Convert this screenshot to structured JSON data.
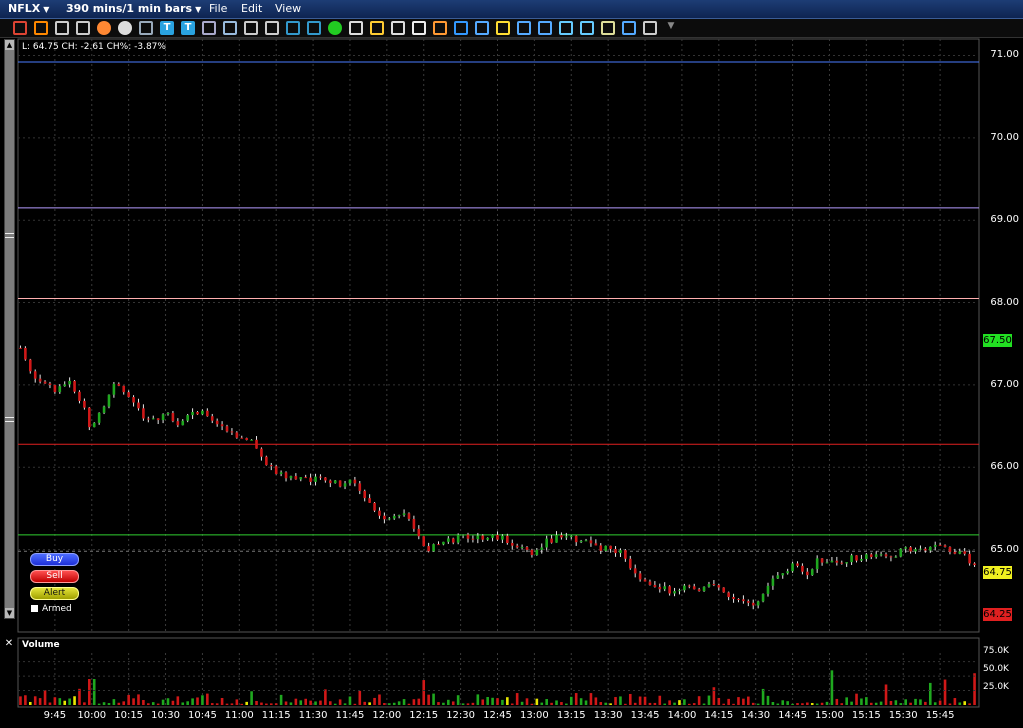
{
  "window": {
    "symbol": "NFLX",
    "timeframe": "390 mins/1 min bars",
    "menu": [
      "File",
      "Edit",
      "View"
    ]
  },
  "toolbar": {
    "icons": [
      "crosshair-icon",
      "arrow-tool-icon",
      "grid-icon",
      "print-icon",
      "snapshot-icon",
      "circle-icon",
      "zoom-window-icon",
      "text-t-icon",
      "text-t2-icon",
      "chart-image-icon",
      "chart-line-icon",
      "layout-icon",
      "layout2-icon",
      "bar-chart-icon",
      "bars-icon",
      "dollar-icon",
      "pointer-icon",
      "zoom-in-icon",
      "zoom-out-icon",
      "hand-icon",
      "crosshair2-icon",
      "undo-icon",
      "settings-icon",
      "paint-icon",
      "ruler-icon",
      "line-tool-icon",
      "line-tool2-icon",
      "line-tool3-icon",
      "resize-icon",
      "pan-icon",
      "wrench-icon",
      "dropdown-icon"
    ]
  },
  "chart": {
    "info": "L: 64.75 CH: -2.61 CH%: -3.87%",
    "y_labels": [
      "71.00",
      "70.00",
      "69.00",
      "68.00",
      "67.00",
      "66.00",
      "65.00"
    ],
    "price_tags": {
      "high": "67.50",
      "last": "64.75",
      "low": "64.25"
    },
    "colors": {
      "up": "#1fa81f",
      "down": "#d01818",
      "background": "#000000"
    },
    "order_buttons": {
      "buy": "Buy",
      "sell": "Sell",
      "alert": "Alert"
    },
    "armed_label": "Armed"
  },
  "volume": {
    "title": "Volume",
    "y_labels": [
      "75.0K",
      "50.0K",
      "25.0K"
    ]
  },
  "x_axis": [
    "9:45",
    "10:00",
    "10:15",
    "10:30",
    "10:45",
    "11:00",
    "11:15",
    "11:30",
    "11:45",
    "12:00",
    "12:15",
    "12:30",
    "12:45",
    "13:00",
    "13:15",
    "13:30",
    "13:45",
    "14:00",
    "14:15",
    "14:30",
    "14:45",
    "15:00",
    "15:15",
    "15:30",
    "15:45"
  ],
  "chart_data": {
    "type": "candlestick",
    "symbol": "NFLX",
    "interval": "1 min",
    "x_range": [
      "9:30",
      "16:00"
    ],
    "ylim": [
      64.0,
      71.2
    ],
    "horizontal_lines": [
      {
        "price": 70.92,
        "color": "#4a7cff"
      },
      {
        "price": 69.15,
        "color": "#b59cff"
      },
      {
        "price": 68.05,
        "color": "#ffb0b0"
      },
      {
        "price": 66.28,
        "color": "#e02020"
      },
      {
        "price": 65.18,
        "color": "#30d030"
      }
    ],
    "price_keypoints": [
      [
        "9:31",
        67.45
      ],
      [
        "9:35",
        67.15
      ],
      [
        "9:40",
        67.05
      ],
      [
        "9:45",
        66.95
      ],
      [
        "9:50",
        67.05
      ],
      [
        "9:55",
        66.85
      ],
      [
        "10:00",
        66.45
      ],
      [
        "10:05",
        66.75
      ],
      [
        "10:10",
        67.05
      ],
      [
        "10:15",
        66.85
      ],
      [
        "10:20",
        66.65
      ],
      [
        "10:25",
        66.55
      ],
      [
        "10:30",
        66.65
      ],
      [
        "10:35",
        66.55
      ],
      [
        "10:40",
        66.65
      ],
      [
        "10:45",
        66.7
      ],
      [
        "10:50",
        66.55
      ],
      [
        "10:55",
        66.4
      ],
      [
        "11:00",
        66.35
      ],
      [
        "11:05",
        66.3
      ],
      [
        "11:10",
        66.1
      ],
      [
        "11:15",
        65.95
      ],
      [
        "11:20",
        65.85
      ],
      [
        "11:25",
        65.9
      ],
      [
        "11:30",
        65.85
      ],
      [
        "11:35",
        65.85
      ],
      [
        "11:40",
        65.8
      ],
      [
        "11:45",
        65.85
      ],
      [
        "11:50",
        65.65
      ],
      [
        "11:55",
        65.45
      ],
      [
        "12:00",
        65.4
      ],
      [
        "12:05",
        65.45
      ],
      [
        "12:10",
        65.35
      ],
      [
        "12:15",
        65.0
      ],
      [
        "12:20",
        65.05
      ],
      [
        "12:25",
        65.1
      ],
      [
        "12:30",
        65.15
      ],
      [
        "12:35",
        65.1
      ],
      [
        "12:40",
        65.18
      ],
      [
        "12:45",
        65.15
      ],
      [
        "12:50",
        65.1
      ],
      [
        "12:55",
        65.05
      ],
      [
        "13:00",
        64.92
      ],
      [
        "13:05",
        65.1
      ],
      [
        "13:10",
        65.15
      ],
      [
        "13:15",
        65.15
      ],
      [
        "13:20",
        65.1
      ],
      [
        "13:25",
        65.05
      ],
      [
        "13:30",
        65.0
      ],
      [
        "13:35",
        64.95
      ],
      [
        "13:40",
        64.7
      ],
      [
        "13:45",
        64.65
      ],
      [
        "13:50",
        64.55
      ],
      [
        "13:55",
        64.5
      ],
      [
        "14:00",
        64.55
      ],
      [
        "14:05",
        64.5
      ],
      [
        "14:10",
        64.6
      ],
      [
        "14:15",
        64.5
      ],
      [
        "14:20",
        64.45
      ],
      [
        "14:25",
        64.35
      ],
      [
        "14:30",
        64.3
      ],
      [
        "14:35",
        64.55
      ],
      [
        "14:40",
        64.7
      ],
      [
        "14:45",
        64.8
      ],
      [
        "14:50",
        64.7
      ],
      [
        "14:55",
        64.85
      ],
      [
        "15:00",
        64.9
      ],
      [
        "15:05",
        64.85
      ],
      [
        "15:10",
        64.9
      ],
      [
        "15:15",
        64.95
      ],
      [
        "15:20",
        64.95
      ],
      [
        "15:25",
        64.92
      ],
      [
        "15:30",
        65.0
      ],
      [
        "15:35",
        65.02
      ],
      [
        "15:40",
        64.98
      ],
      [
        "15:45",
        65.08
      ],
      [
        "15:50",
        65.0
      ],
      [
        "15:55",
        64.95
      ],
      [
        "15:59",
        64.8
      ]
    ],
    "volume_ylim": [
      0,
      90000
    ]
  }
}
